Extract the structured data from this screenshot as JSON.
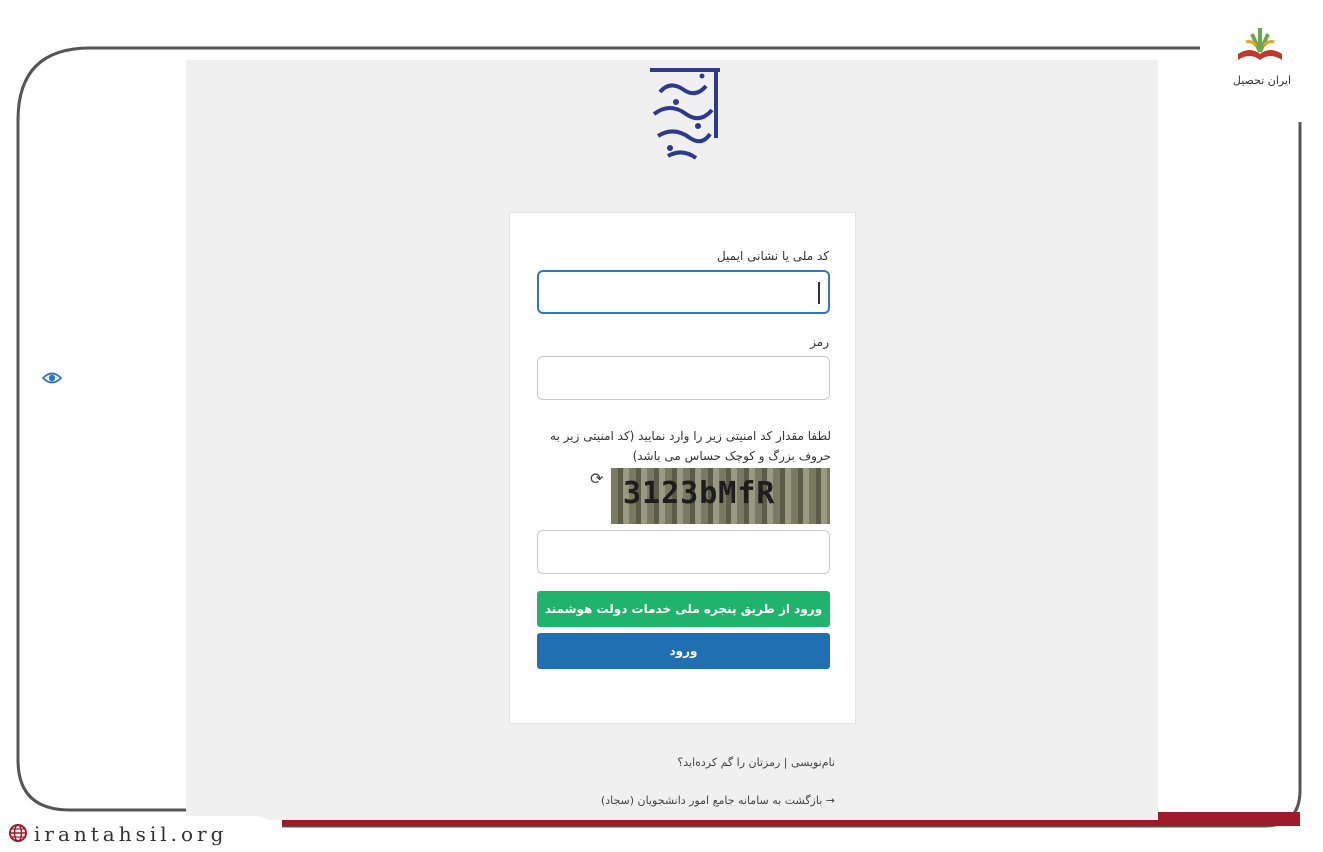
{
  "login_form": {
    "username_label": "کد ملی یا نشانی ایمیل",
    "username_value": "",
    "password_label": "رمز",
    "password_value": "",
    "captcha_help": "لطفا مقدار کد امنیتی زیر را وارد نمایید (کد امنیتی زیر به حروف بزرگ و کوچک حساس می باشد)",
    "captcha_code": "3123bMfR",
    "captcha_value": "",
    "sso_button": "ورود از طریق پنجره ملی خدمات دولت هوشمند",
    "login_button": "ورود"
  },
  "links": {
    "register_and_forgot": "نام‌نویسی | رمزتان را گم کرده‌اید؟",
    "back_to_portal": "→ بازگشت به سامانه جامع امور دانشجویان (سجاد)"
  },
  "watermark": {
    "brand_name": "ایران تحصیل",
    "url": "irantahsil.org"
  },
  "logo": {
    "text": "سازمان امور دانشجویان"
  },
  "colors": {
    "sso_button": "#1fb36b",
    "login_button": "#1f6fb2",
    "focus_border": "#2f78b7",
    "frame_red": "#9e1b2b",
    "logo_blue": "#2d3a8c"
  },
  "icons": {
    "eye": "eye-icon",
    "refresh": "refresh-icon",
    "globe": "globe-icon"
  }
}
